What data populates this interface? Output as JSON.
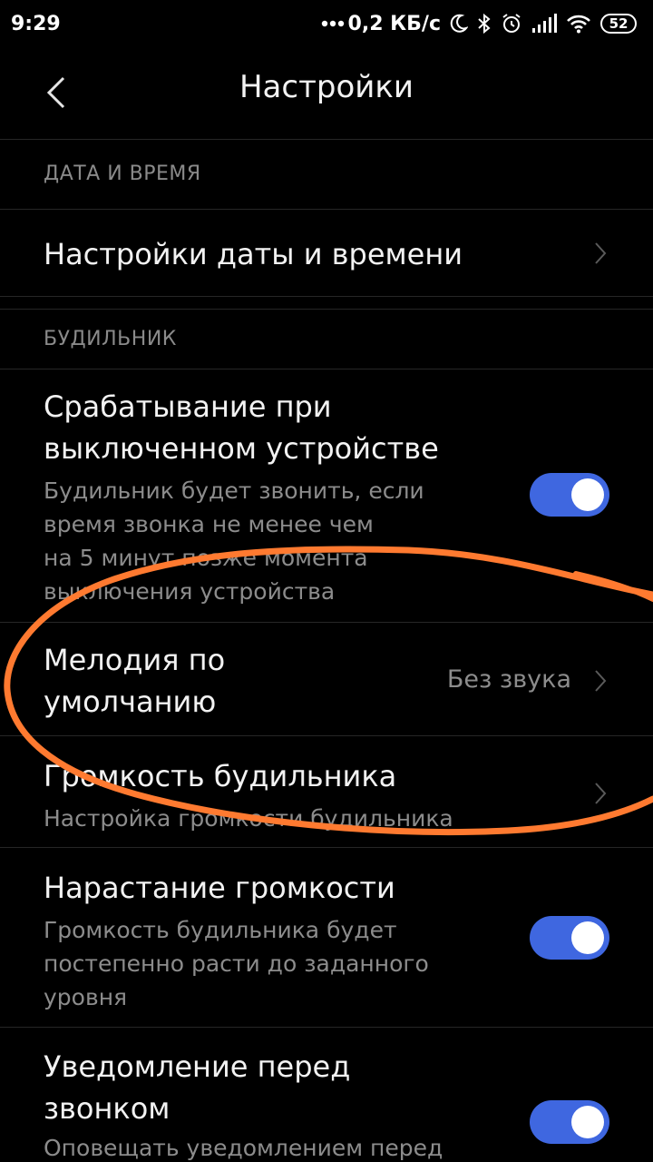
{
  "status_bar": {
    "time": "9:29",
    "network_speed": "0,2 КБ/с",
    "battery": "52",
    "icons": [
      "more-dots-icon",
      "moon-icon",
      "bluetooth-icon",
      "alarm-clock-icon",
      "signal-icon",
      "wifi-icon",
      "battery-icon"
    ]
  },
  "header": {
    "title": "Настройки",
    "back_icon": "chevron-left-icon"
  },
  "sections": {
    "date_time": {
      "header": "ДАТА И ВРЕМЯ",
      "items": [
        {
          "title": "Настройки даты и времени"
        }
      ]
    },
    "alarm": {
      "header": "БУДИЛЬНИК",
      "items": [
        {
          "title": "Срабатывание при\nвыключенном устройстве",
          "subtitle": "Будильник будет звонить, если\nвремя звонка не менее чем\nна 5 минут позже момента\nвыключения устройства",
          "toggle": true
        },
        {
          "title": "Мелодия по\nумолчанию",
          "value": "Без звука"
        },
        {
          "title": "Громкость будильника",
          "subtitle": "Настройка громкости будильника"
        },
        {
          "title": "Нарастание громкости",
          "subtitle": "Громкость будильника будет\nпостепенно расти до заданного\nуровня",
          "toggle": true
        },
        {
          "title": "Уведомление перед\nзвонком",
          "subtitle": "Оповещать уведомлением перед",
          "toggle": true
        }
      ]
    }
  },
  "colors": {
    "background": "#000000",
    "toggle_on": "#3f67e0",
    "annotation": "#ff7a30",
    "secondary_text": "#8c8c8c"
  }
}
